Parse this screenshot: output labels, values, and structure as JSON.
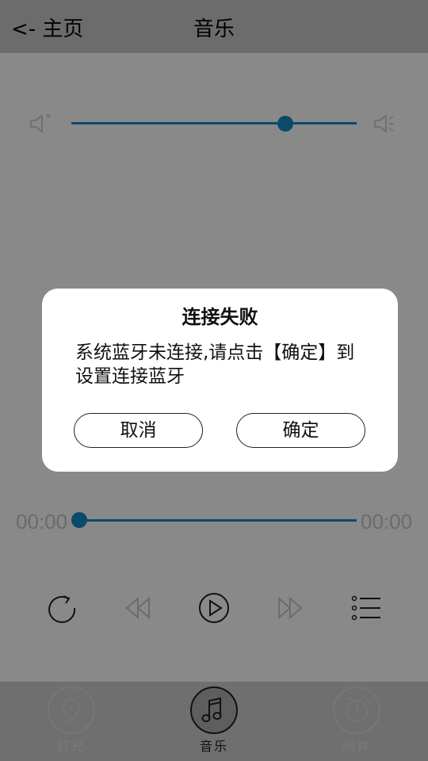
{
  "header": {
    "back_label": "<- 主页",
    "title": "音乐"
  },
  "volume": {
    "level": 0.75,
    "min_icon": "volume-mute-icon",
    "max_icon": "volume-up-icon"
  },
  "progress": {
    "current_time": "00:00",
    "total_time": "00:00",
    "position": 0
  },
  "controls": [
    {
      "name": "repeat-icon"
    },
    {
      "name": "previous-icon"
    },
    {
      "name": "play-icon"
    },
    {
      "name": "next-icon"
    },
    {
      "name": "playlist-icon"
    }
  ],
  "tabs": [
    {
      "label": "灯光",
      "icon": "bulb-icon",
      "active": false
    },
    {
      "label": "音乐",
      "icon": "music-note-icon",
      "active": true
    },
    {
      "label": "闹钟",
      "icon": "alarm-clock-icon",
      "active": false
    }
  ],
  "dialog": {
    "title": "连接失败",
    "message": "系统蓝牙未连接,请点击【确定】到设置连接蓝牙",
    "cancel_label": "取消",
    "confirm_label": "确定"
  },
  "colors": {
    "accent": "#0b4a6b",
    "overlay": "#898989",
    "header": "#6c6c6c"
  }
}
